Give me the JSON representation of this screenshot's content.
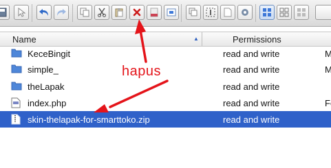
{
  "toolbar": {
    "buttons": [
      {
        "name": "save-icon"
      },
      {
        "name": "pointer-icon"
      },
      {
        "name": "undo-icon"
      },
      {
        "name": "redo-icon"
      },
      {
        "name": "copy-icon"
      },
      {
        "name": "cut-icon"
      },
      {
        "name": "paste-icon"
      },
      {
        "name": "delete-icon"
      },
      {
        "name": "disabled-icon"
      },
      {
        "name": "preview-icon"
      },
      {
        "name": "duplicate-icon"
      },
      {
        "name": "select-icon"
      },
      {
        "name": "new-file-icon"
      },
      {
        "name": "settings-icon"
      },
      {
        "name": "view-grid-icon",
        "active": true
      },
      {
        "name": "view-thumbnails-icon"
      },
      {
        "name": "view-large-icon"
      }
    ]
  },
  "table": {
    "columns": {
      "name": "Name",
      "permissions": "Permissions"
    },
    "rows": [
      {
        "name": "KeceBingit",
        "type": "folder",
        "permissions": "read and write",
        "extra": "Ma",
        "selected": false
      },
      {
        "name": "simple_",
        "type": "folder",
        "permissions": "read and write",
        "extra": "Ma",
        "selected": false
      },
      {
        "name": "theLapak",
        "type": "folder",
        "permissions": "read and write",
        "extra": "",
        "selected": false
      },
      {
        "name": "index.php",
        "type": "php-file",
        "permissions": "read and write",
        "extra": "Fe",
        "selected": false
      },
      {
        "name": "skin-thelapak-for-smarttoko.zip",
        "type": "zip-file",
        "permissions": "read and write",
        "extra": "",
        "selected": true
      }
    ]
  },
  "annotation": {
    "label": "hapus",
    "color": "#e4141a"
  },
  "colors": {
    "selection": "#2f61c9",
    "folder": "#4f87d9",
    "annotation": "#e4141a"
  }
}
